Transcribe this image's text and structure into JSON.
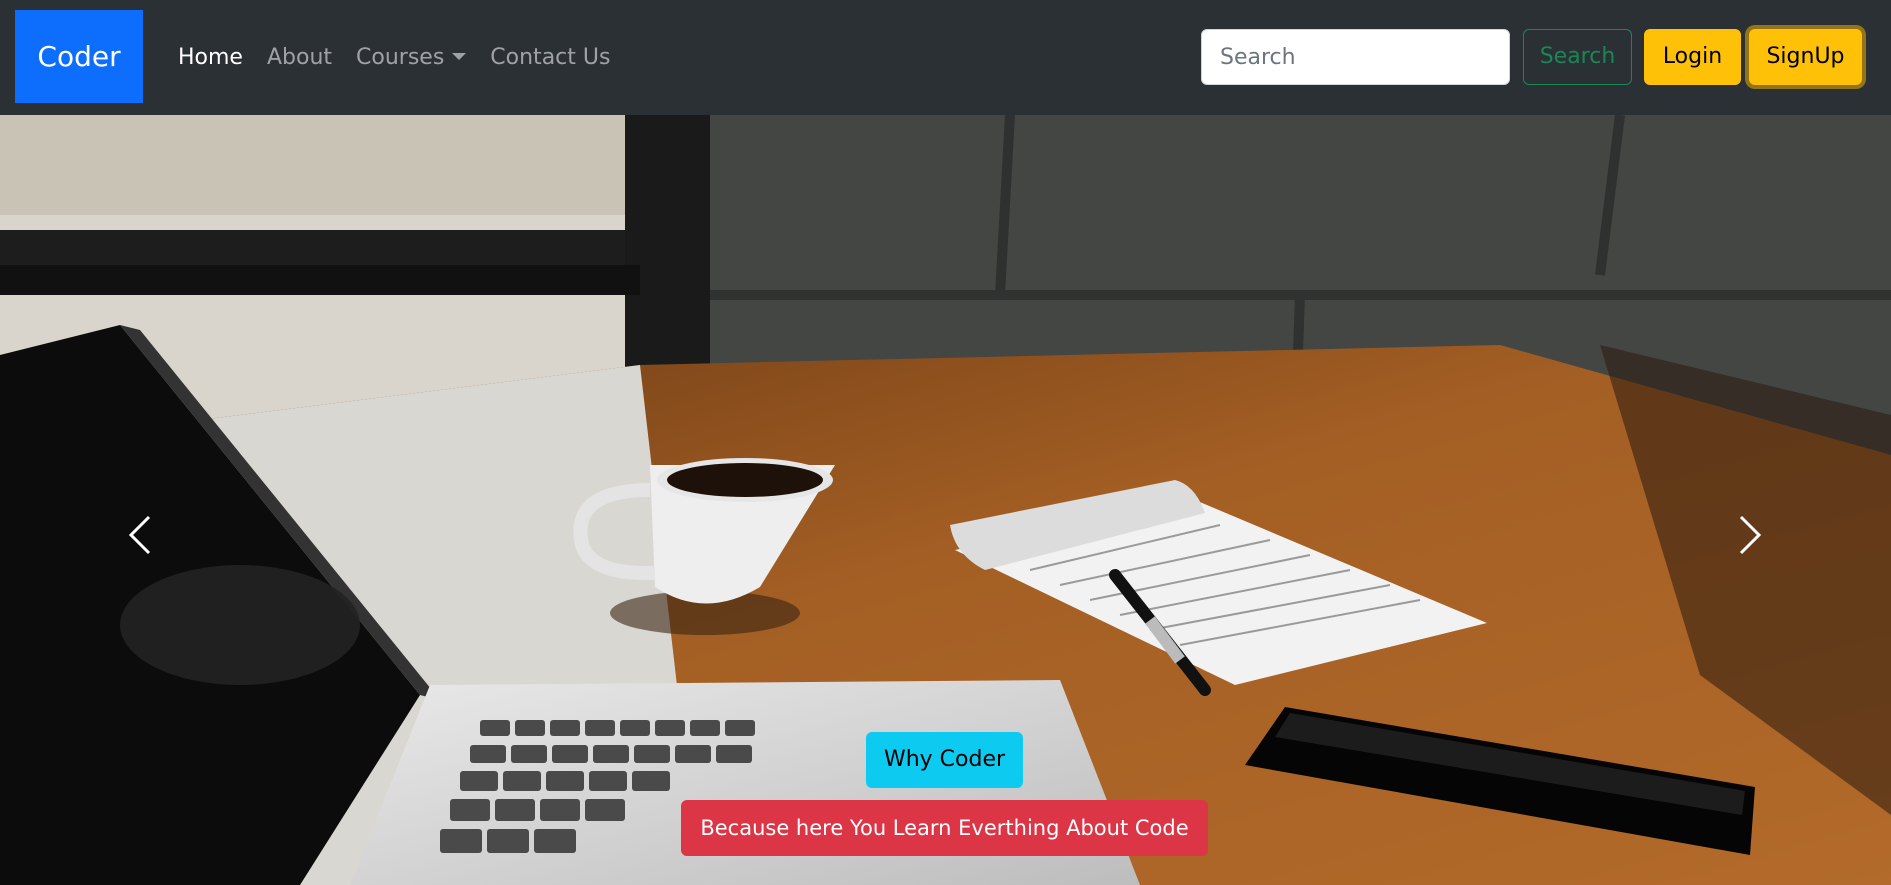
{
  "navbar": {
    "brand": "Coder",
    "links": [
      {
        "label": "Home"
      },
      {
        "label": "About"
      },
      {
        "label": "Courses"
      },
      {
        "label": "Contact Us"
      }
    ],
    "search_placeholder": "Search",
    "search_button": "Search",
    "login_button": "Login",
    "signup_button": "SignUp"
  },
  "carousel": {
    "image_icon": "desk-workspace-photo",
    "prev_icon": "chevron-left-icon",
    "next_icon": "chevron-right-icon",
    "caption_heading": "Why Coder",
    "caption_text": "Because here You Learn Everthing About Code"
  },
  "colors": {
    "navbar_bg": "#2b3035",
    "brand_bg": "#0d6efd",
    "search_button": "#198754",
    "login_bg": "#ffc107",
    "signup_bg": "#ffc107",
    "caption_heading_bg": "#0dcaf0",
    "caption_text_bg": "#dc3545"
  }
}
